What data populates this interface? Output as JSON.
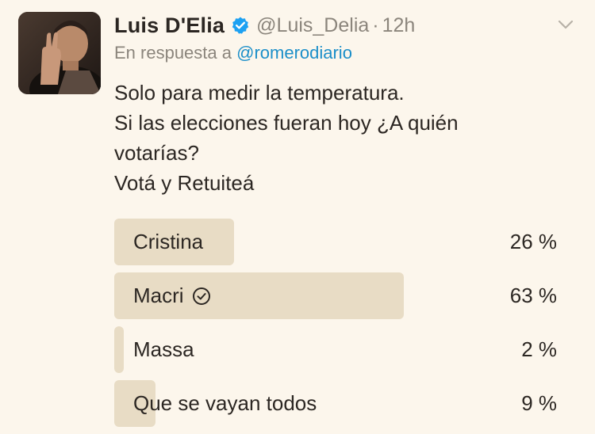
{
  "author": {
    "display_name": "Luis D'Elia",
    "handle": "@Luis_Delia",
    "separator": "·",
    "time": "12h",
    "verified": true
  },
  "reply": {
    "prefix": "En respuesta a",
    "mention": "@romerodiario"
  },
  "tweet": {
    "lines": [
      "Solo para medir la temperatura.",
      "Si las elecciones fueran hoy ¿A quién",
      "votarías?",
      "Votá y Retuiteá"
    ]
  },
  "poll": {
    "options": [
      {
        "label": "Cristina",
        "percent": 26,
        "percent_label": "26 %",
        "selected": false
      },
      {
        "label": "Macri",
        "percent": 63,
        "percent_label": "63 %",
        "selected": true
      },
      {
        "label": "Massa",
        "percent": 2,
        "percent_label": "2 %",
        "selected": false
      },
      {
        "label": "Que se vayan todos",
        "percent": 9,
        "percent_label": "9 %",
        "selected": false
      }
    ]
  },
  "colors": {
    "background": "#fcf6ec",
    "bar": "#e8dcc5",
    "link": "#1c8fc9",
    "verified": "#1da1f2",
    "muted": "#8b857c"
  },
  "icons": {
    "verified": "verified-badge-icon",
    "menu": "chevron-down-icon",
    "selected": "check-circle-icon"
  }
}
